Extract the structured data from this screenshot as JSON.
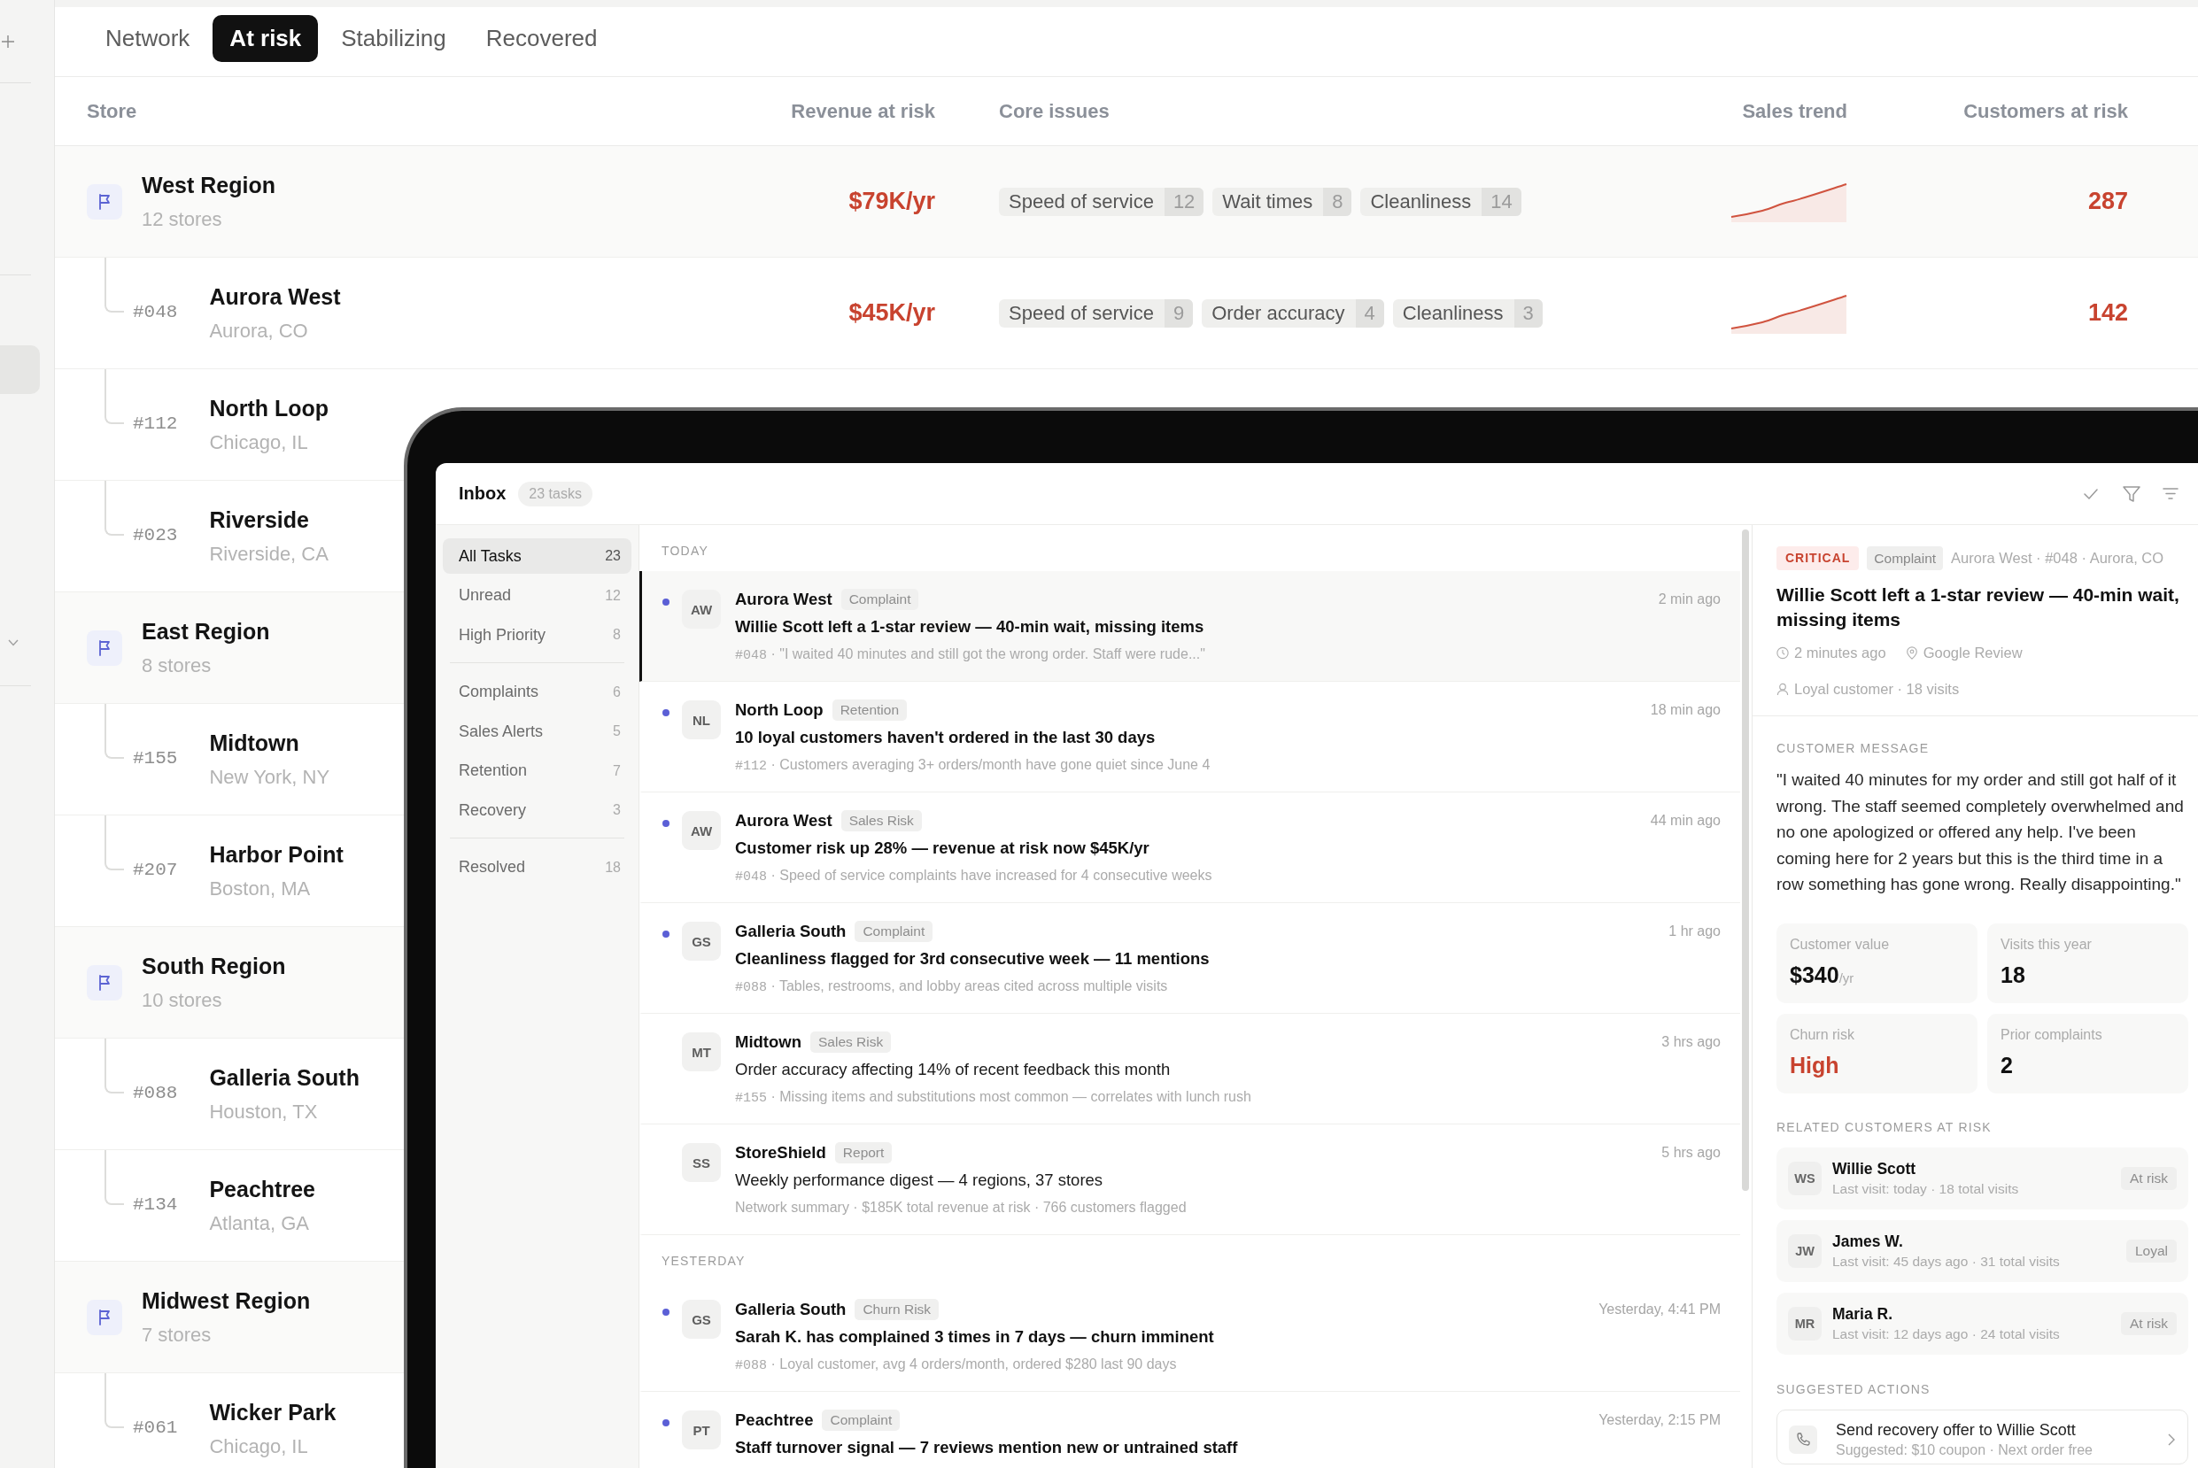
{
  "rail": {
    "items": [
      {
        "kind": "add"
      },
      {
        "kind": "nav",
        "selected": true
      },
      {
        "kind": "collapse"
      }
    ]
  },
  "tabs": [
    {
      "label": "Network",
      "selected": false
    },
    {
      "label": "At risk",
      "selected": true
    },
    {
      "label": "Stabilizing",
      "selected": false
    },
    {
      "label": "Recovered",
      "selected": false
    }
  ],
  "table": {
    "columns": [
      "Store",
      "Revenue at risk",
      "Core issues",
      "Sales trend",
      "Customers at risk"
    ],
    "rows": [
      {
        "name": "West Region",
        "subtitle": "12 stores",
        "revenue": "$79K/yr",
        "issues": [
          {
            "label": "Speed of service",
            "count": "12"
          },
          {
            "label": "Wait times",
            "count": "8"
          },
          {
            "label": "Cleanliness",
            "count": "14"
          }
        ],
        "customers": "287",
        "children": [
          {
            "number": "#048",
            "name": "Aurora West",
            "city": "Aurora, CO",
            "revenue": "$45K/yr",
            "issues": [
              {
                "label": "Speed of service",
                "count": "9"
              },
              {
                "label": "Order accuracy",
                "count": "4"
              },
              {
                "label": "Cleanliness",
                "count": "3"
              }
            ],
            "customers": "142"
          },
          {
            "number": "#112",
            "name": "North Loop",
            "city": "Chicago, IL"
          },
          {
            "number": "#023",
            "name": "Riverside",
            "city": "Riverside, CA"
          }
        ]
      },
      {
        "name": "East Region",
        "subtitle": "8 stores",
        "children": [
          {
            "number": "#155",
            "name": "Midtown",
            "city": "New York, NY"
          },
          {
            "number": "#207",
            "name": "Harbor Point",
            "city": "Boston, MA"
          }
        ]
      },
      {
        "name": "South Region",
        "subtitle": "10 stores",
        "children": [
          {
            "number": "#088",
            "name": "Galleria South",
            "city": "Houston, TX"
          },
          {
            "number": "#134",
            "name": "Peachtree",
            "city": "Atlanta, GA"
          }
        ]
      },
      {
        "name": "Midwest Region",
        "subtitle": "7 stores",
        "children": [
          {
            "number": "#061",
            "name": "Wicker Park",
            "city": "Chicago, IL"
          }
        ]
      }
    ]
  },
  "inbox": {
    "title": "Inbox",
    "count": "23 tasks",
    "folder_groups": [
      {
        "items": [
          {
            "label": "All Tasks",
            "count": "23",
            "selected": true
          },
          {
            "label": "Unread",
            "count": "12",
            "selected": false
          },
          {
            "label": "High Priority",
            "count": "8",
            "selected": false
          }
        ]
      },
      {
        "items": [
          {
            "label": "Complaints",
            "count": "6",
            "selected": false
          },
          {
            "label": "Sales Alerts",
            "count": "5",
            "selected": false
          },
          {
            "label": "Retention",
            "count": "7",
            "selected": false
          },
          {
            "label": "Recovery",
            "count": "3",
            "selected": false
          }
        ]
      },
      {
        "items": [
          {
            "label": "Resolved",
            "count": "18",
            "selected": false
          }
        ]
      }
    ],
    "sections": [
      {
        "label": "TODAY",
        "items": [
          {
            "initials": "AW",
            "store": "Aurora West",
            "tag": "Complaint",
            "time": "2 min ago",
            "title": "Willie Scott left a 1-star review — 40-min wait, missing items",
            "store_number": "#048",
            "snippet": "· \"I waited 40 minutes and still got the wrong order. Staff were rude...\"",
            "unread": true,
            "selected": true
          },
          {
            "initials": "NL",
            "store": "North Loop",
            "tag": "Retention",
            "time": "18 min ago",
            "title": "10 loyal customers haven't ordered in the last 30 days",
            "store_number": "#112",
            "snippet": "· Customers averaging 3+ orders/month have gone quiet since June 4",
            "unread": true,
            "selected": false
          },
          {
            "initials": "AW",
            "store": "Aurora West",
            "tag": "Sales Risk",
            "time": "44 min ago",
            "title": "Customer risk up 28% — revenue at risk now $45K/yr",
            "store_number": "#048",
            "snippet": "· Speed of service complaints have increased for 4 consecutive weeks",
            "unread": true,
            "selected": false
          },
          {
            "initials": "GS",
            "store": "Galleria South",
            "tag": "Complaint",
            "time": "1 hr ago",
            "title": "Cleanliness flagged for 3rd consecutive week — 11 mentions",
            "store_number": "#088",
            "snippet": "· Tables, restrooms, and lobby areas cited across multiple visits",
            "unread": true,
            "selected": false
          },
          {
            "initials": "MT",
            "store": "Midtown",
            "tag": "Sales Risk",
            "time": "3 hrs ago",
            "title": "Order accuracy affecting 14% of recent feedback this month",
            "store_number": "#155",
            "snippet": "· Missing items and substitutions most common — correlates with lunch rush",
            "unread": false,
            "selected": false
          },
          {
            "initials": "SS",
            "store": "StoreShield",
            "tag": "Report",
            "time": "5 hrs ago",
            "title": "Weekly performance digest — 4 regions, 37 stores",
            "snippet": "Network summary · $185K total revenue at risk · 766 customers flagged",
            "unread": false,
            "selected": false
          }
        ]
      },
      {
        "label": "YESTERDAY",
        "items": [
          {
            "initials": "GS",
            "store": "Galleria South",
            "tag": "Churn Risk",
            "time": "Yesterday, 4:41 PM",
            "title": "Sarah K. has complained 3 times in 7 days — churn imminent",
            "store_number": "#088",
            "snippet": "· Loyal customer, avg 4 orders/month, ordered $280 last 90 days",
            "unread": true,
            "selected": false
          },
          {
            "initials": "PT",
            "store": "Peachtree",
            "tag": "Complaint",
            "time": "Yesterday, 2:15 PM",
            "title": "Staff turnover signal — 7 reviews mention new or untrained staff",
            "unread": true,
            "selected": false
          }
        ]
      }
    ]
  },
  "detail": {
    "severity": "CRITICAL",
    "tag": "Complaint",
    "location": "Aurora West · #048 · Aurora, CO",
    "title": "Willie Scott left a 1-star review — 40-min wait, missing items",
    "time": "2 minutes ago",
    "source": "Google Review",
    "customer": "Loyal customer · 18 visits",
    "message_label": "CUSTOMER MESSAGE",
    "message": "\"I waited 40 minutes for my order and still got half of it wrong. The staff seemed completely overwhelmed and no one apologized or offered any help. I've been coming here for 2 years but this is the third time in a row something has gone wrong. Really disappointing.\"",
    "stats": [
      {
        "label": "Customer value",
        "value": "$340",
        "unit": "/yr",
        "alert": false
      },
      {
        "label": "Visits this year",
        "value": "18",
        "alert": false
      },
      {
        "label": "Churn risk",
        "value": "High",
        "alert": true
      },
      {
        "label": "Prior complaints",
        "value": "2",
        "alert": false
      }
    ],
    "related_label": "RELATED CUSTOMERS AT RISK",
    "related": [
      {
        "initials": "WS",
        "name": "Willie Scott",
        "detail": "Last visit: today · 18 total visits",
        "status": "At risk"
      },
      {
        "initials": "JW",
        "name": "James W.",
        "detail": "Last visit: 45 days ago · 31 total visits",
        "status": "Loyal"
      },
      {
        "initials": "MR",
        "name": "Maria R.",
        "detail": "Last visit: 12 days ago · 24 total visits",
        "status": "At risk"
      }
    ],
    "actions_label": "SUGGESTED ACTIONS",
    "actions": [
      {
        "title": "Send recovery offer to Willie Scott",
        "detail": "Suggested: $10 coupon · Next order free"
      }
    ]
  }
}
